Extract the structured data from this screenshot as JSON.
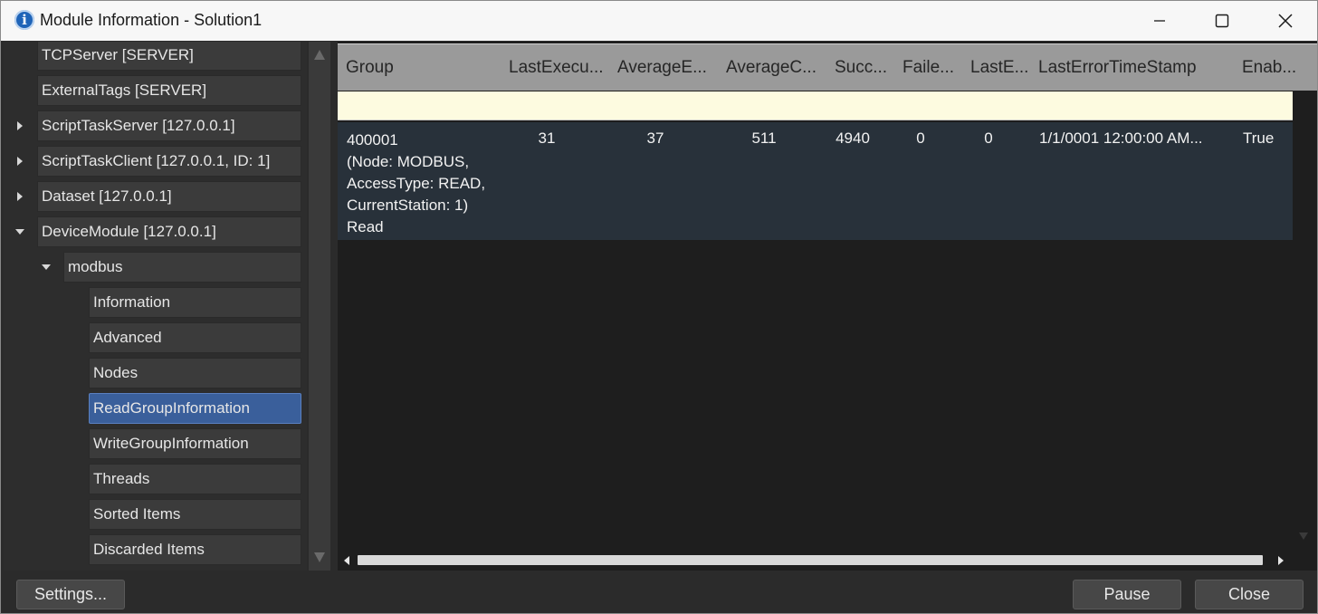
{
  "window": {
    "title": "Module Information - Solution1",
    "icon": "info-icon"
  },
  "tree": {
    "items": [
      {
        "label": "TCPServer [SERVER]",
        "level": 0,
        "expander": "none",
        "selected": false
      },
      {
        "label": "ExternalTags [SERVER]",
        "level": 0,
        "expander": "none",
        "selected": false
      },
      {
        "label": "ScriptTaskServer [127.0.0.1]",
        "level": 0,
        "expander": "collapsed",
        "selected": false
      },
      {
        "label": "ScriptTaskClient [127.0.0.1, ID: 1]",
        "level": 0,
        "expander": "collapsed",
        "selected": false
      },
      {
        "label": "Dataset [127.0.0.1]",
        "level": 0,
        "expander": "collapsed",
        "selected": false
      },
      {
        "label": "DeviceModule [127.0.0.1]",
        "level": 0,
        "expander": "expanded",
        "selected": false
      },
      {
        "label": "modbus",
        "level": 1,
        "expander": "expanded",
        "selected": false
      },
      {
        "label": "Information",
        "level": 2,
        "expander": "none",
        "selected": false
      },
      {
        "label": "Advanced",
        "level": 2,
        "expander": "none",
        "selected": false
      },
      {
        "label": "Nodes",
        "level": 2,
        "expander": "none",
        "selected": false
      },
      {
        "label": "ReadGroupInformation",
        "level": 2,
        "expander": "none",
        "selected": true
      },
      {
        "label": "WriteGroupInformation",
        "level": 2,
        "expander": "none",
        "selected": false
      },
      {
        "label": "Threads",
        "level": 2,
        "expander": "none",
        "selected": false
      },
      {
        "label": "Sorted Items",
        "level": 2,
        "expander": "none",
        "selected": false
      },
      {
        "label": "Discarded Items",
        "level": 2,
        "expander": "none",
        "selected": false
      }
    ]
  },
  "grid": {
    "columns": [
      "Group",
      "LastExecu...",
      "AverageE...",
      "AverageC...",
      "Succ...",
      "Faile...",
      "LastE...",
      "LastErrorTimeStamp",
      "Enab..."
    ],
    "rows": [
      {
        "group_lines": [
          "400001",
          "(Node: MODBUS,",
          "AccessType: READ,",
          "CurrentStation: 1)",
          "Read"
        ],
        "cells": [
          "31",
          "37",
          "511",
          "4940",
          "0",
          "0",
          "1/1/0001 12:00:00 AM...",
          "True"
        ]
      }
    ]
  },
  "buttons": {
    "settings": "Settings...",
    "pause": "Pause",
    "close": "Close"
  },
  "colors": {
    "selected_item": "#3a5f9b",
    "filter_row": "#fdfbe0",
    "data_row": "#28313a",
    "header": "#9a9a9a"
  }
}
